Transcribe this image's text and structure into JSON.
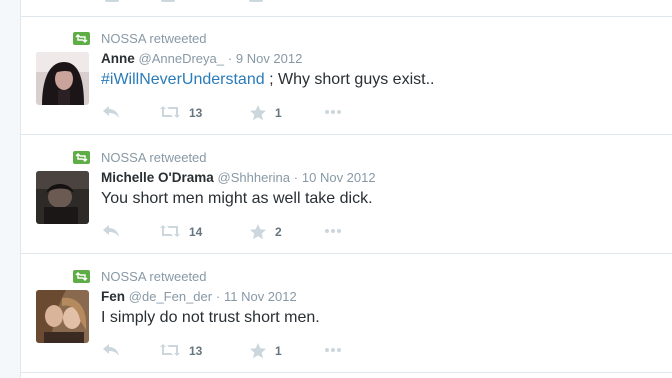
{
  "retweet_label": "retweeted",
  "tweets": [
    {
      "retweeter": "NOSSA",
      "fullname": "Anne",
      "username": "@AnneDreya_",
      "separator": "·",
      "time": "9 Nov 2012",
      "hashtag": "#iWillNeverUnderstand",
      "text": " ; Why short guys exist..",
      "retweets": "13",
      "favorites": "1"
    },
    {
      "retweeter": "NOSSA",
      "fullname": "Michelle O'Drama",
      "username": "@Shhherina",
      "separator": "·",
      "time": "10 Nov 2012",
      "hashtag": "",
      "text": "You short men might as well take dick.",
      "retweets": "14",
      "favorites": "2"
    },
    {
      "retweeter": "NOSSA",
      "fullname": "Fen",
      "username": "@de_Fen_der",
      "separator": "·",
      "time": "11 Nov 2012",
      "hashtag": "",
      "text": "I simply do not trust short men.",
      "retweets": "13",
      "favorites": "1"
    }
  ],
  "colors": {
    "retweet_badge": "#5fad47",
    "link": "#2b7bb9",
    "muted": "#8899a6",
    "action_icon": "#ccd6dd"
  }
}
